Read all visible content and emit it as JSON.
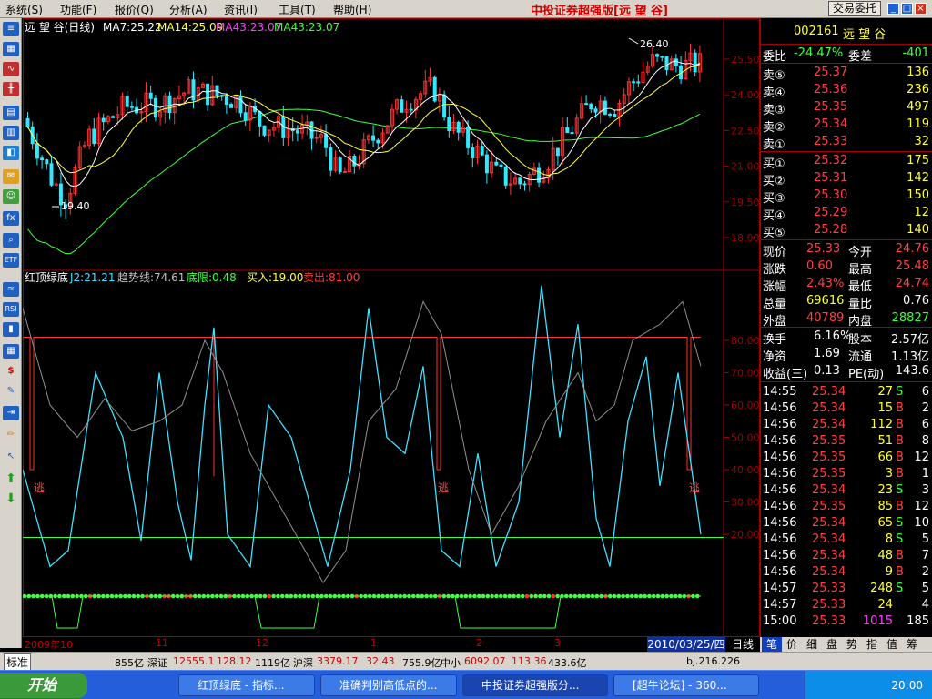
{
  "menu": {
    "items": [
      "系统(S)",
      "功能(F)",
      "报价(Q)",
      "分析(A)",
      "资讯(I)",
      "工具(T)",
      "帮助(H)"
    ],
    "app_title": "中投证券超强版[远 望 谷]",
    "trade_button": "交易委托"
  },
  "chart_header": {
    "stock": "远 望 谷(日线)",
    "ma7": "MA7:25.22",
    "ma14": "MA14:25.09",
    "ma43": "MA43:23.07",
    "ma43b": "MA43:23.07"
  },
  "indicator_header": {
    "name": "红顶绿底",
    "j2": "J2:21.21",
    "trend": "趋势线:74.61",
    "bottom": "底限:0.48",
    "buy": "买入:19.00",
    "sell": "卖出:81.00"
  },
  "price_axis": [
    "25.50",
    "24.00",
    "22.50",
    "21.00",
    "19.50",
    "18.00"
  ],
  "indicator_axis": [
    "80.00",
    "70.00",
    "60.00",
    "50.00",
    "40.00",
    "30.00",
    "20.00"
  ],
  "annotations": {
    "high": "26.40",
    "low": "19.40",
    "escape": "逃"
  },
  "month_axis": [
    "2009年10",
    "11",
    "12",
    "1",
    "2",
    "3"
  ],
  "date_label": "2010/03/25/四",
  "daily_label": "日线",
  "quote": {
    "code": "002161",
    "name": "远 望 谷",
    "wei_bi_label": "委比",
    "wei_bi": "-24.47%",
    "wei_cha_label": "委差",
    "wei_cha": "-401",
    "sells": [
      {
        "label": "卖⑤",
        "price": "25.37",
        "vol": "136"
      },
      {
        "label": "卖④",
        "price": "25.36",
        "vol": "236"
      },
      {
        "label": "卖③",
        "price": "25.35",
        "vol": "497"
      },
      {
        "label": "卖②",
        "price": "25.34",
        "vol": "119"
      },
      {
        "label": "卖①",
        "price": "25.33",
        "vol": "32"
      }
    ],
    "buys": [
      {
        "label": "买①",
        "price": "25.32",
        "vol": "175"
      },
      {
        "label": "买②",
        "price": "25.31",
        "vol": "142"
      },
      {
        "label": "买③",
        "price": "25.30",
        "vol": "150"
      },
      {
        "label": "买④",
        "price": "25.29",
        "vol": "12"
      },
      {
        "label": "买⑤",
        "price": "25.28",
        "vol": "140"
      }
    ],
    "stats": [
      {
        "l1": "现价",
        "v1": "25.33",
        "l2": "今开",
        "v2": "24.76",
        "c1": "#ff4040",
        "c2": "#ff4040"
      },
      {
        "l1": "涨跌",
        "v1": "0.60",
        "l2": "最高",
        "v2": "25.48",
        "c1": "#ff4040",
        "c2": "#ff4040"
      },
      {
        "l1": "涨幅",
        "v1": "2.43%",
        "l2": "最低",
        "v2": "24.74",
        "c1": "#ff4040",
        "c2": "#ff4040"
      },
      {
        "l1": "总量",
        "v1": "69616",
        "l2": "量比",
        "v2": "0.76",
        "c1": "#ffff40",
        "c2": "#ffffff"
      },
      {
        "l1": "外盘",
        "v1": "40789",
        "l2": "内盘",
        "v2": "28827",
        "c1": "#ff4040",
        "c2": "#40ff40"
      }
    ],
    "stats2": [
      {
        "l1": "换手",
        "v1": "6.16%",
        "l2": "股本",
        "v2": "2.57亿"
      },
      {
        "l1": "净资",
        "v1": "1.69",
        "l2": "流通",
        "v2": "1.13亿"
      },
      {
        "l1": "收益(三)",
        "v1": "0.13",
        "l2": "PE(动)",
        "v2": "143.6"
      }
    ],
    "ticks": [
      {
        "time": "14:55",
        "price": "25.34",
        "vol": "27",
        "bs": "S",
        "n": "6"
      },
      {
        "time": "14:56",
        "price": "25.34",
        "vol": "15",
        "bs": "B",
        "n": "2"
      },
      {
        "time": "14:56",
        "price": "25.34",
        "vol": "112",
        "bs": "B",
        "n": "6"
      },
      {
        "time": "14:56",
        "price": "25.35",
        "vol": "51",
        "bs": "B",
        "n": "8"
      },
      {
        "time": "14:56",
        "price": "25.35",
        "vol": "66",
        "bs": "B",
        "n": "12"
      },
      {
        "time": "14:56",
        "price": "25.35",
        "vol": "3",
        "bs": "B",
        "n": "1"
      },
      {
        "time": "14:56",
        "price": "25.34",
        "vol": "23",
        "bs": "S",
        "n": "3"
      },
      {
        "time": "14:56",
        "price": "25.35",
        "vol": "85",
        "bs": "B",
        "n": "12"
      },
      {
        "time": "14:56",
        "price": "25.34",
        "vol": "65",
        "bs": "S",
        "n": "10"
      },
      {
        "time": "14:56",
        "price": "25.34",
        "vol": "8",
        "bs": "S",
        "n": "5"
      },
      {
        "time": "14:56",
        "price": "25.34",
        "vol": "48",
        "bs": "B",
        "n": "7"
      },
      {
        "time": "14:56",
        "price": "25.34",
        "vol": "9",
        "bs": "B",
        "n": "2"
      },
      {
        "time": "14:57",
        "price": "25.33",
        "vol": "248",
        "bs": "S",
        "n": "5"
      },
      {
        "time": "14:57",
        "price": "25.33",
        "vol": "24",
        "bs": "",
        "n": "4"
      },
      {
        "time": "15:00",
        "price": "25.33",
        "vol": "1015",
        "bs": "",
        "n": "185"
      }
    ]
  },
  "bottom_tabs": [
    "笔",
    "价",
    "细",
    "盘",
    "势",
    "指",
    "值",
    "筹"
  ],
  "status": {
    "mode": "标准",
    "sh": "855亿",
    "sz_label": "深证",
    "sz_val": "12555.1",
    "sz_chg": "128.12",
    "sz_amt": "1119亿",
    "hs_label": "沪深",
    "hs_val": "3379.17",
    "hs_chg": "32.43",
    "hs_amt": "755.9亿",
    "zx_label": "中小",
    "zx_val": "6092.07",
    "zx_chg": "113.36",
    "zx_amt": "433.6亿",
    "server": "bj.216.226"
  },
  "taskbar": {
    "start": "开始",
    "tasks": [
      "红顶绿底 - 指标...",
      "准确判别高低点的...",
      "中投证券超强版分...",
      "[超牛论坛] - 360..."
    ],
    "clock": "20:00"
  },
  "colors": {
    "red": "#ff4040",
    "green": "#40ff40",
    "cyan": "#40e0ff",
    "yellow": "#ffff40",
    "magenta": "#ff40ff"
  }
}
